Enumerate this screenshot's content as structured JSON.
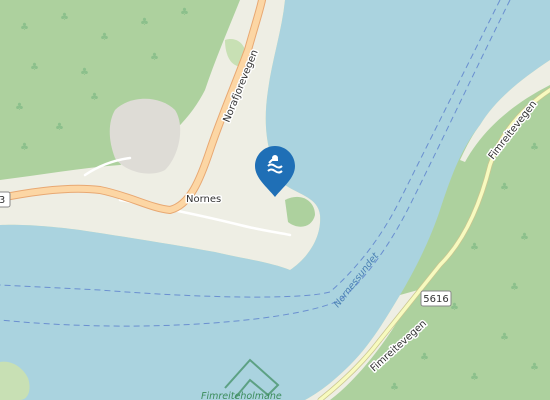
{
  "map": {
    "colors": {
      "water": "#aad3df",
      "forest": "#add19e",
      "land": "#f2efe9",
      "residential": "#e0dfdf",
      "primary_road": "#fcd6a4",
      "road_casing": "#e8a872",
      "tertiary_road": "#f7fabf",
      "pin": "#1f6fb6"
    },
    "labels": {
      "village": "Nornes",
      "road_west": "Norafjorevegen",
      "road_east_upper": "Fimreitevegen",
      "road_east_lower": "Fimreitevegen",
      "road_number": "5616",
      "road_number_left": "3",
      "strait": "Nornessundet",
      "protected_area": "Fimreiteholmane"
    },
    "poi": {
      "icon": "swimming-icon",
      "type": "bathing spot"
    }
  }
}
